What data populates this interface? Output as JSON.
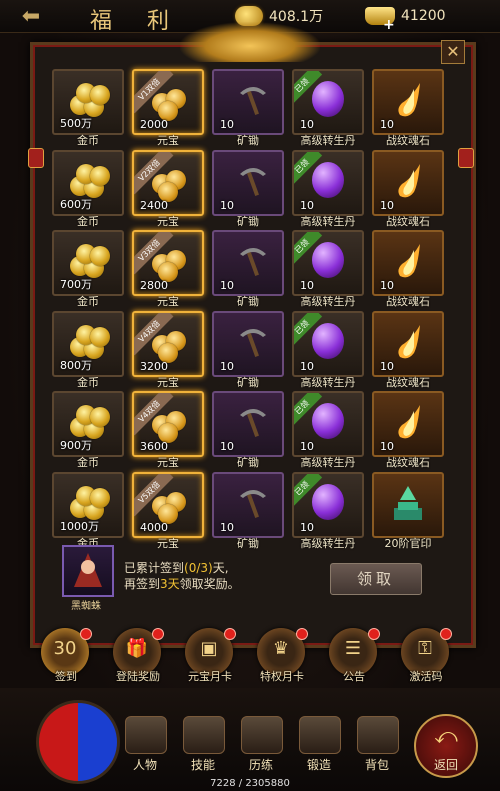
{
  "header": {
    "title": "福 利",
    "currency_1": "408.1万",
    "currency_2": "41200"
  },
  "rows": [
    {
      "tier": "",
      "coins": "500万",
      "yuanbao": "2000",
      "ribbon": "V1双倍"
    },
    {
      "tier": "",
      "coins": "600万",
      "yuanbao": "2400",
      "ribbon": "V2双倍"
    },
    {
      "tier": "",
      "coins": "700万",
      "yuanbao": "2800",
      "ribbon": "V3双倍"
    },
    {
      "tier": "",
      "coins": "800万",
      "yuanbao": "3200",
      "ribbon": "V4双倍"
    },
    {
      "tier": "",
      "coins": "900万",
      "yuanbao": "3600",
      "ribbon": "V4双倍"
    },
    {
      "tier": "",
      "coins": "1000万",
      "yuanbao": "4000",
      "ribbon": "V5双倍"
    }
  ],
  "labels": {
    "coin": "金币",
    "yuanbao": "元宝",
    "pick": "矿锄",
    "gem": "高级转生丹",
    "stone": "战纹魂石",
    "seal": "20阶官印",
    "qty10": "10",
    "gem_ribbon": "已领"
  },
  "sign": {
    "avatar_label": "黑蜘蛛",
    "line1_a": "已累计签到",
    "line1_b": "(0/3)",
    "line1_c": "天,",
    "line2_a": "再签到",
    "line2_b": "3天",
    "line2_c": "领取奖励。",
    "claim": "领取"
  },
  "tabs": [
    {
      "label": "签到",
      "glyph": "30"
    },
    {
      "label": "登陆奖励",
      "glyph": "🎁"
    },
    {
      "label": "元宝月卡",
      "glyph": "▣"
    },
    {
      "label": "特权月卡",
      "glyph": "♛"
    },
    {
      "label": "公告",
      "glyph": "☰"
    },
    {
      "label": "激活码",
      "glyph": "⚿"
    }
  ],
  "bottom": {
    "b1": "人物",
    "b2": "技能",
    "b3": "历练",
    "b4": "锻造",
    "b5": "背包",
    "back": "返回",
    "exp": "7228 / 2305880"
  }
}
